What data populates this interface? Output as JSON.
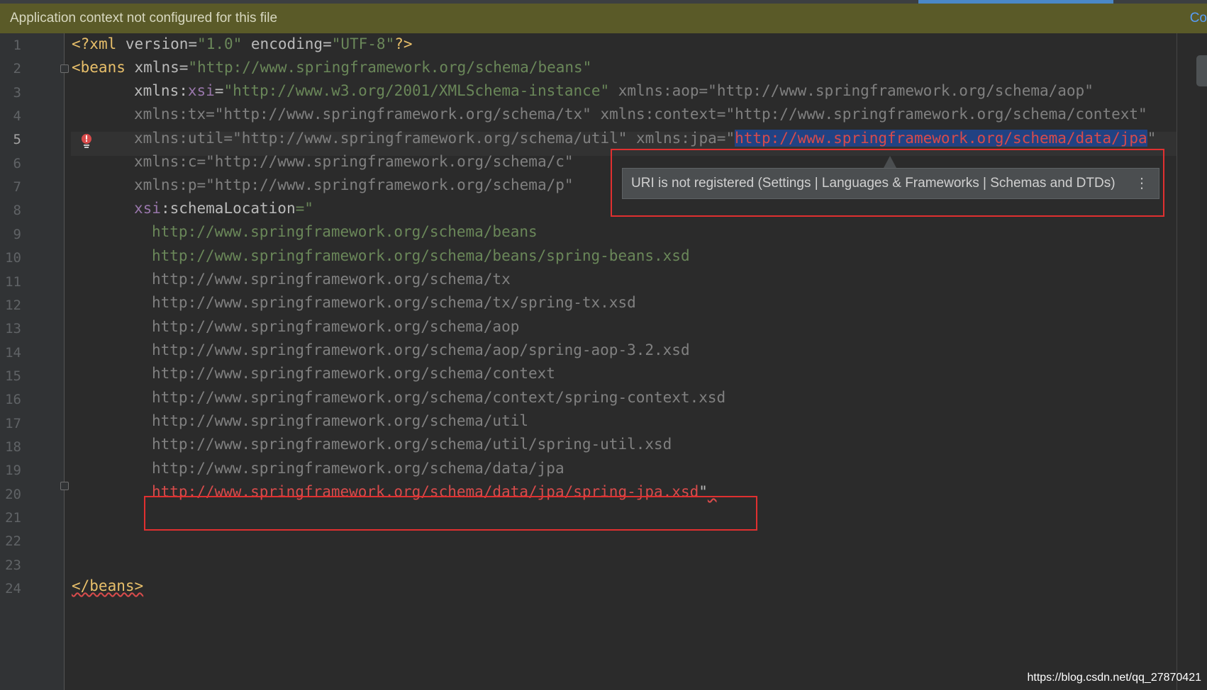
{
  "banner": {
    "message": "Application context not configured for this file",
    "right_text": "Co"
  },
  "line_numbers": [
    "1",
    "2",
    "3",
    "4",
    "5",
    "6",
    "7",
    "8",
    "9",
    "10",
    "11",
    "12",
    "13",
    "14",
    "15",
    "16",
    "17",
    "18",
    "19",
    "20",
    "21",
    "22",
    "23",
    "24"
  ],
  "current_line": "5",
  "code": {
    "l1": {
      "a": "<?",
      "b": "xml ",
      "c": "version",
      "d": "=",
      "e": "\"1.0\"",
      "f": " encoding",
      "g": "=",
      "h": "\"UTF-8\"",
      "i": "?>"
    },
    "l2": {
      "a": "<beans ",
      "b": "xmlns",
      "c": "=",
      "d": "\"http://www.springframework.org/schema/beans\""
    },
    "l3": {
      "a": "xmlns:",
      "b": "xsi",
      "c": "=",
      "d": "\"http://www.w3.org/2001/XMLSchema-instance\"",
      "e": " xmlns:aop=\"http://www.springframework.org/schema/aop\""
    },
    "l4": {
      "a": "xmlns:tx=\"http://www.springframework.org/schema/tx\" xmlns:context=\"http://www.springframework.org/schema/context\""
    },
    "l5": {
      "a": "xmlns:util=\"http://www.springframework.org/schema/util\" xmlns:jpa=\"",
      "b": "http://www.springframework.org/schema/data/jpa",
      "c": "\""
    },
    "l6": "xmlns:c=\"http://www.springframework.org/schema/c\"",
    "l7": "xmlns:p=\"http://www.springframework.org/schema/p\"",
    "l8": {
      "a": "xsi",
      "b": ":schemaLocation",
      "c": "=\""
    },
    "l9": "http://www.springframework.org/schema/beans",
    "l10": "http://www.springframework.org/schema/beans/spring-beans.xsd",
    "l11": "http://www.springframework.org/schema/tx",
    "l12": "http://www.springframework.org/schema/tx/spring-tx.xsd",
    "l13": "http://www.springframework.org/schema/aop",
    "l14": "http://www.springframework.org/schema/aop/spring-aop-3.2.xsd",
    "l15": "http://www.springframework.org/schema/context",
    "l16": "http://www.springframework.org/schema/context/spring-context.xsd",
    "l17": "http://www.springframework.org/schema/util",
    "l18": "http://www.springframework.org/schema/util/spring-util.xsd",
    "l19": "http://www.springframework.org/schema/data/jpa",
    "l20": {
      "a": "http://www.springframework.org/schema/data/jpa/spring-jpa.xsd",
      "b": "\"",
      "c": " "
    },
    "l23": "</beans>"
  },
  "tooltip": {
    "message": "URI is not registered (Settings | Languages & Frameworks | Schemas and DTDs)",
    "menu_glyph": "⋮"
  },
  "watermark": "https://blog.csdn.net/qq_27870421",
  "colors": {
    "banner_bg": "#5a5a28",
    "editor_bg": "#2b2b2b",
    "error_red": "#d84b4b",
    "selection": "#214283",
    "annotation_box": "#e03030"
  }
}
